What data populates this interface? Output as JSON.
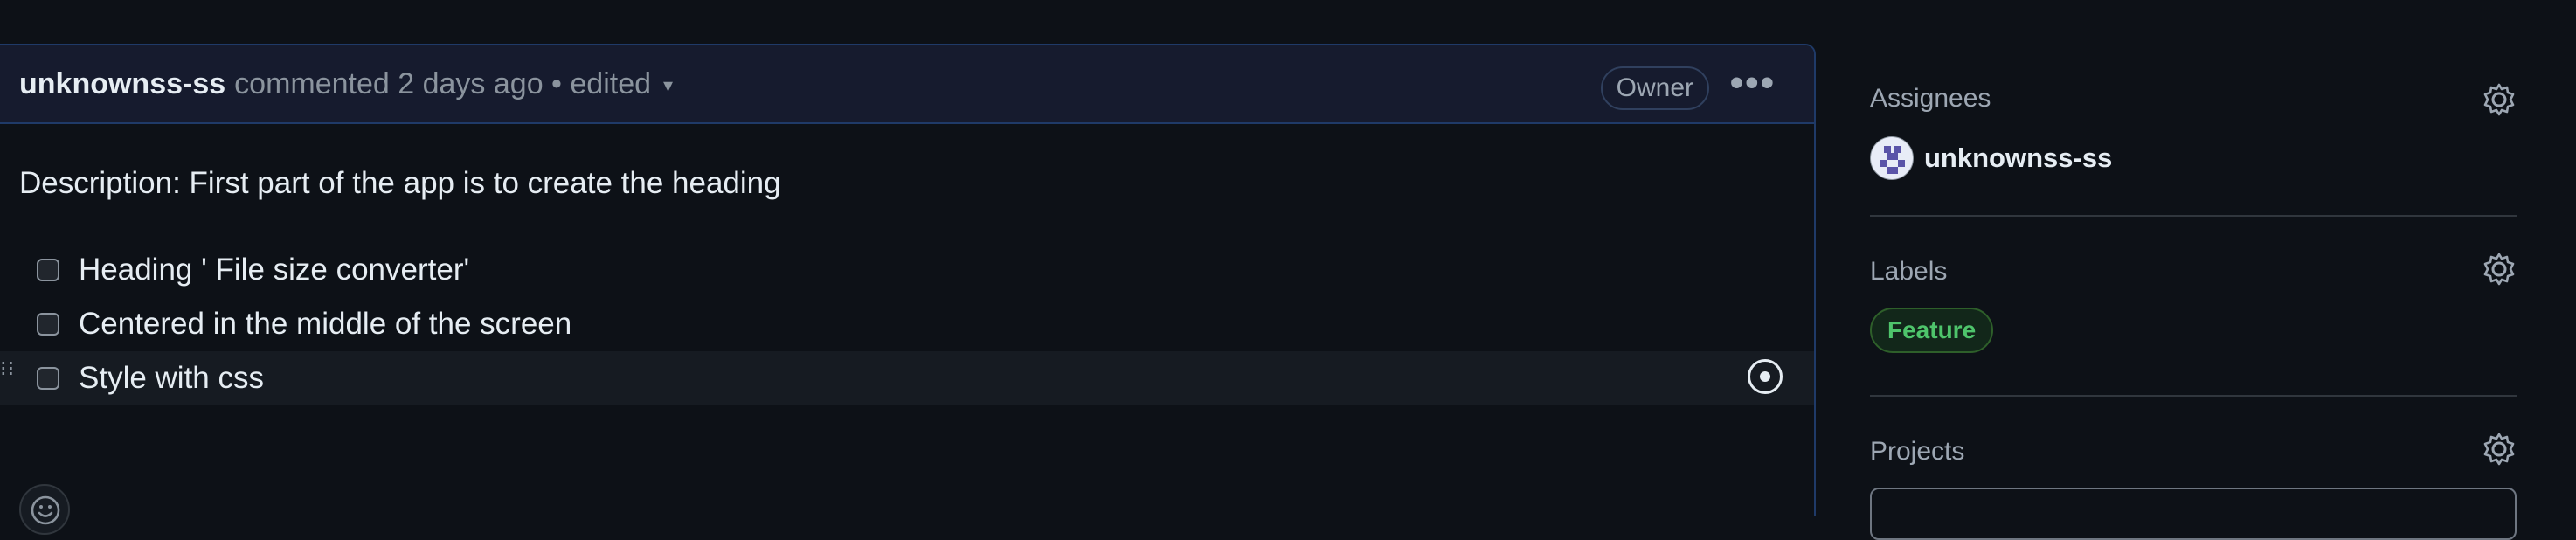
{
  "comment": {
    "author": "unknownss-ss",
    "meta": "commented 2 days ago • edited",
    "caret": "▾",
    "owner_badge": "Owner",
    "more": "•••",
    "description": "Description: First part of the app is to create the heading",
    "tasks": [
      {
        "label": "Heading ' File size converter'",
        "checked": false
      },
      {
        "label": "Centered in the middle of the screen",
        "checked": false
      },
      {
        "label": "Style with css",
        "checked": false
      }
    ]
  },
  "sidebar": {
    "assignees": {
      "title": "Assignees",
      "user": "unknownss-ss"
    },
    "labels": {
      "title": "Labels",
      "items": [
        "Feature"
      ]
    },
    "projects": {
      "title": "Projects"
    }
  },
  "colors": {
    "background": "#0d1117",
    "header": "#161b2e",
    "accent_border": "#1f3a68",
    "label_green": "#4ec46b"
  }
}
